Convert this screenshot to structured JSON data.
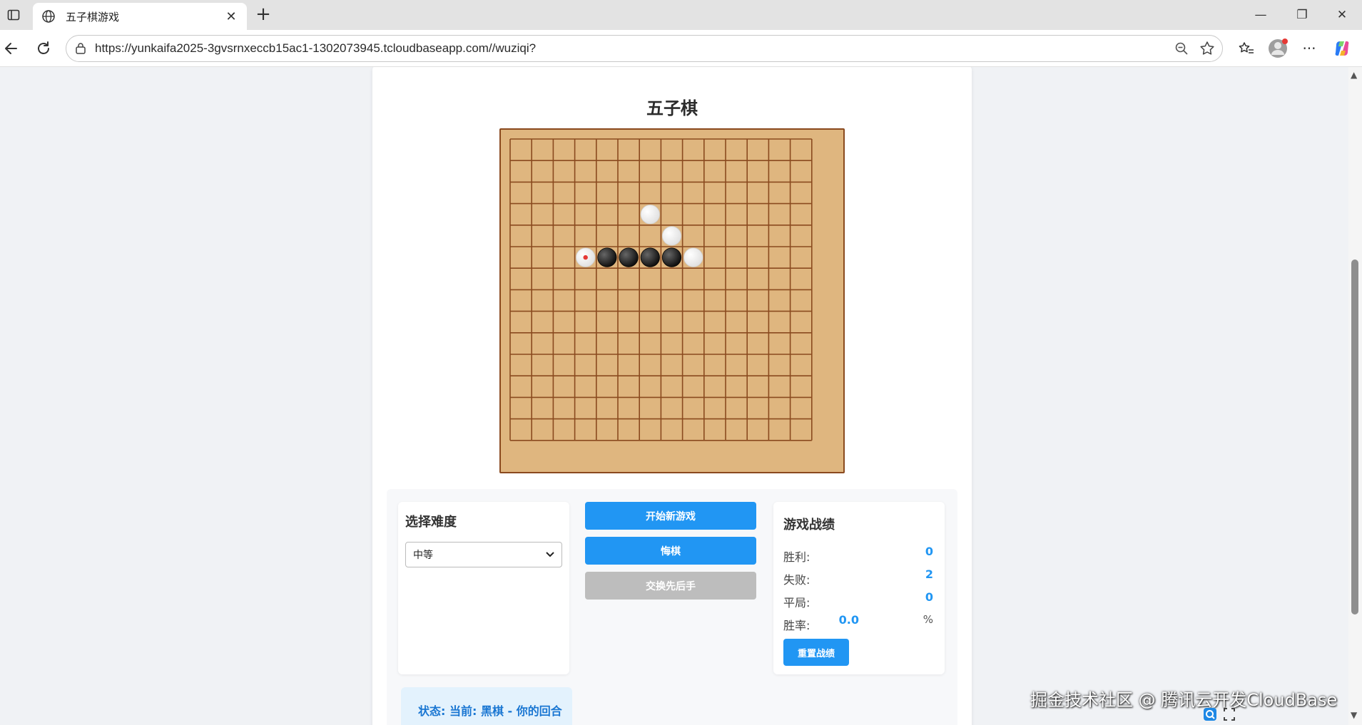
{
  "browser": {
    "tab_title": "五子棋游戏",
    "url": "https://yunkaifa2025-3gvsrnxeccb15ac1-1302073945.tcloudbaseapp.com//wuziqi?"
  },
  "game": {
    "title": "五子棋",
    "board_size": 15,
    "stones": [
      {
        "color": "white",
        "col": 6,
        "row": 3
      },
      {
        "color": "white",
        "col": 7,
        "row": 4
      },
      {
        "color": "white",
        "col": 3,
        "row": 5,
        "last_move": true
      },
      {
        "color": "black",
        "col": 4,
        "row": 5
      },
      {
        "color": "black",
        "col": 5,
        "row": 5
      },
      {
        "color": "black",
        "col": 6,
        "row": 5
      },
      {
        "color": "black",
        "col": 7,
        "row": 5
      },
      {
        "color": "white",
        "col": 8,
        "row": 5
      }
    ]
  },
  "difficulty": {
    "title": "选择难度",
    "selected": "中等"
  },
  "buttons": {
    "new_game": "开始新游戏",
    "undo": "悔棋",
    "swap": "交换先后手"
  },
  "stats": {
    "title": "游戏战绩",
    "wins_label": "胜利:",
    "wins": "0",
    "losses_label": "失败:",
    "losses": "2",
    "draws_label": "平局:",
    "draws": "0",
    "rate_label": "胜率:",
    "rate": "0.0",
    "rate_unit": "%",
    "reset": "重置战绩"
  },
  "status": {
    "text": "状态: 当前: 黑棋 - 你的回合"
  },
  "watermark": "掘金技术社区 @ 腾讯云开发CloudBase",
  "colors": {
    "accent": "#2196f3",
    "board": "#dfb67f",
    "grid": "#8a4a1f",
    "disabled": "#bdbdbd",
    "last_move_marker": "#e53935"
  }
}
